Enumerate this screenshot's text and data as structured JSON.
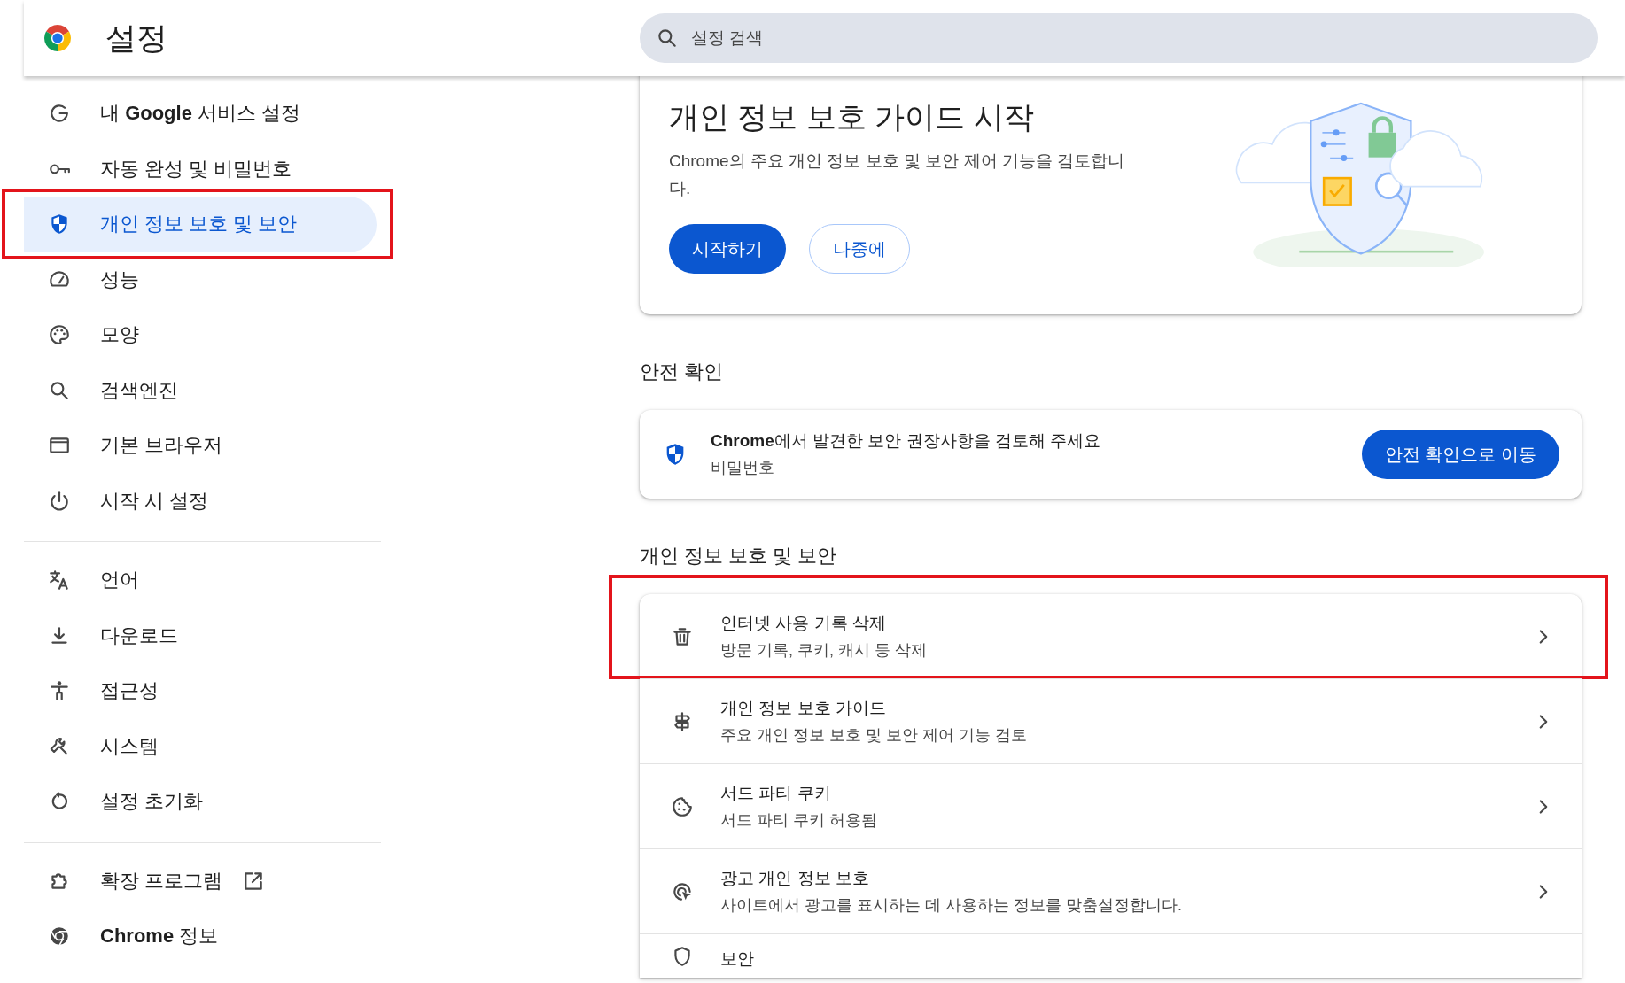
{
  "header": {
    "title": "설정",
    "search": {
      "placeholder": "설정 검색"
    }
  },
  "sidebar": {
    "groups": [
      [
        {
          "label": "내 **Google** 서비스 설정",
          "selected": false,
          "annotated": false,
          "external": false
        },
        {
          "label": "자동 완성 및 비밀번호",
          "selected": false,
          "annotated": false,
          "external": false
        },
        {
          "label": "개인 정보 보호 및 보안",
          "selected": true,
          "annotated": true,
          "external": false
        },
        {
          "label": "성능",
          "selected": false,
          "annotated": false,
          "external": false
        },
        {
          "label": "모양",
          "selected": false,
          "annotated": false,
          "external": false
        },
        {
          "label": "검색엔진",
          "selected": false,
          "annotated": false,
          "external": false
        },
        {
          "label": "기본 브라우저",
          "selected": false,
          "annotated": false,
          "external": false
        },
        {
          "label": "시작 시 설정",
          "selected": false,
          "annotated": false,
          "external": false
        }
      ],
      [
        {
          "label": "언어",
          "selected": false,
          "annotated": false,
          "external": false
        },
        {
          "label": "다운로드",
          "selected": false,
          "annotated": false,
          "external": false
        },
        {
          "label": "접근성",
          "selected": false,
          "annotated": false,
          "external": false
        },
        {
          "label": "시스템",
          "selected": false,
          "annotated": false,
          "external": false
        },
        {
          "label": "설정 초기화",
          "selected": false,
          "annotated": false,
          "external": false
        }
      ],
      [
        {
          "label": "확장 프로그램",
          "selected": false,
          "annotated": false,
          "external": true
        },
        {
          "label": "**Chrome** 정보",
          "selected": false,
          "annotated": false,
          "external": false
        }
      ]
    ]
  },
  "guide_card": {
    "title": "개인 정보 보호 가이드 시작",
    "description": "Chrome의 주요 개인 정보 보호 및 보안 제어 기능을 검토합니다.",
    "buttons": [
      {
        "label": "시작하기",
        "kind": "primary"
      },
      {
        "label": "나중에",
        "kind": "outline"
      }
    ]
  },
  "safety_check": {
    "heading": "안전 확인",
    "title": "**Chrome**에서 발견한 보안 권장사항을 검토해 주세요",
    "subtitle": "비밀번호",
    "button": "안전 확인으로 이동"
  },
  "privacy_section": {
    "heading": "개인 정보 보호 및 보안",
    "rows": [
      {
        "title": "인터넷 사용 기록 삭제",
        "subtitle": "방문 기록, 쿠키, 캐시 등 삭제",
        "annotated": true
      },
      {
        "title": "개인 정보 보호 가이드",
        "subtitle": "주요 개인 정보 보호 및 보안 제어 기능 검토",
        "annotated": false
      },
      {
        "title": "서드 파티 쿠키",
        "subtitle": "서드 파티 쿠키 허용됨",
        "annotated": false
      },
      {
        "title": "광고 개인 정보 보호",
        "subtitle": "사이트에서 광고를 표시하는 데 사용하는 정보를 맞춤설정합니다.",
        "annotated": false
      },
      {
        "title": "보안",
        "annotated": false
      }
    ]
  }
}
